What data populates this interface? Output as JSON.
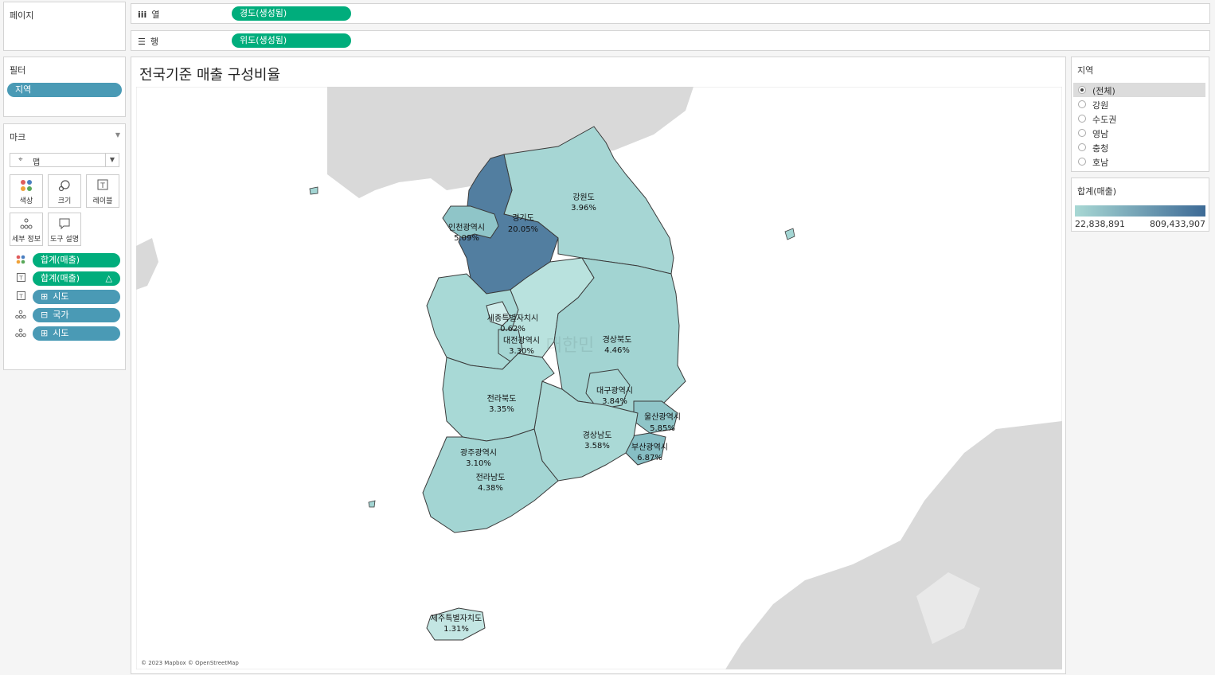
{
  "shelves": {
    "pages": {
      "title": "페이지"
    },
    "columns": {
      "label": "열",
      "pill": "경도(생성됨)"
    },
    "rows": {
      "label": "행",
      "pill": "위도(생성됨)"
    }
  },
  "filters": {
    "title": "필터",
    "pill": "지역"
  },
  "marks": {
    "title": "마크",
    "type_label": "맵",
    "buttons": [
      {
        "label": "색상",
        "icon": "color-icon"
      },
      {
        "label": "크기",
        "icon": "size-icon"
      },
      {
        "label": "레이블",
        "icon": "label-icon"
      },
      {
        "label": "세부 정보",
        "icon": "detail-icon"
      },
      {
        "label": "도구 설명",
        "icon": "tooltip-icon"
      }
    ],
    "fields": [
      {
        "icon": "color-icon",
        "label": "합계(매출)",
        "color": "green"
      },
      {
        "icon": "label-icon",
        "label": "합계(매출)",
        "color": "green",
        "suffix": "△"
      },
      {
        "icon": "label-icon",
        "label": "시도",
        "color": "blue",
        "prefix": "⊞"
      },
      {
        "icon": "detail-icon",
        "label": "국가",
        "color": "blue",
        "prefix": "⊟"
      },
      {
        "icon": "detail-icon",
        "label": "시도",
        "color": "blue",
        "prefix": "⊞"
      }
    ]
  },
  "view": {
    "title": "전국기준 매출 구성비율",
    "attribution": "© 2023 Mapbox © OpenStreetMap",
    "map_watermark": "대한민"
  },
  "region_filter": {
    "title": "지역",
    "options": [
      "(전체)",
      "강원",
      "수도권",
      "영남",
      "충청",
      "호남"
    ],
    "selected": 0
  },
  "legend": {
    "title": "합계(매출)",
    "min_label": "22,838,891",
    "max_label": "809,433,907",
    "color_low": "#a8d8d4",
    "color_high": "#3d6a96"
  },
  "chart_data": {
    "type": "filled-map",
    "measure": "합계(매출)",
    "regions": [
      {
        "name": "경기도",
        "percent": "20.05%"
      },
      {
        "name": "인천광역시",
        "percent": "5.09%"
      },
      {
        "name": "강원도",
        "percent": "3.96%"
      },
      {
        "name": "세종특별자치시",
        "percent": "0.62%"
      },
      {
        "name": "대전광역시",
        "percent": "3.30%"
      },
      {
        "name": "경상북도",
        "percent": "4.46%"
      },
      {
        "name": "대구광역시",
        "percent": "3.84%"
      },
      {
        "name": "전라북도",
        "percent": "3.35%"
      },
      {
        "name": "울산광역시",
        "percent": "5.85%"
      },
      {
        "name": "경상남도",
        "percent": "3.58%"
      },
      {
        "name": "부산광역시",
        "percent": "6.87%"
      },
      {
        "name": "광주광역시",
        "percent": "3.10%"
      },
      {
        "name": "전라남도",
        "percent": "4.38%"
      },
      {
        "name": "제주특별자치도",
        "percent": "1.31%"
      }
    ]
  }
}
